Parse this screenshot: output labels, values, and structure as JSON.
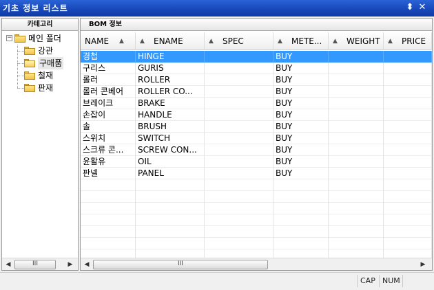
{
  "window": {
    "title": "기초 정보 리스트"
  },
  "title_bar": {
    "menu_glyph": "⬍",
    "close_glyph": "✕"
  },
  "left_panel": {
    "header": "카테고리",
    "tree": {
      "root": {
        "label": "메인 폴더",
        "expander": "−"
      },
      "children": [
        {
          "label": "강관"
        },
        {
          "label": "구매품"
        },
        {
          "label": "철재"
        },
        {
          "label": "판재"
        }
      ]
    },
    "scroll": {
      "left": "◀",
      "right": "▶",
      "thumb": "III"
    }
  },
  "right_panel": {
    "header": "BOM 정보",
    "columns": [
      {
        "label": "NAME"
      },
      {
        "label": "ENAME"
      },
      {
        "label": "SPEC"
      },
      {
        "label": "METE..."
      },
      {
        "label": "WEIGHT"
      },
      {
        "label": "PRICE"
      }
    ],
    "sort_glyph": "▲",
    "rows": [
      {
        "name": "경첩",
        "ename": "HINGE",
        "spec": "",
        "meter": "BUY",
        "weight": "",
        "price": ""
      },
      {
        "name": "구리스",
        "ename": "GURIS",
        "spec": "",
        "meter": "BUY",
        "weight": "",
        "price": ""
      },
      {
        "name": "롤러",
        "ename": "ROLLER",
        "spec": "",
        "meter": "BUY",
        "weight": "",
        "price": ""
      },
      {
        "name": "롤러 콘베어",
        "ename": "ROLLER CO...",
        "spec": "",
        "meter": "BUY",
        "weight": "",
        "price": ""
      },
      {
        "name": "브레이크",
        "ename": "BRAKE",
        "spec": "",
        "meter": "BUY",
        "weight": "",
        "price": ""
      },
      {
        "name": "손잡이",
        "ename": "HANDLE",
        "spec": "",
        "meter": "BUY",
        "weight": "",
        "price": ""
      },
      {
        "name": "솔",
        "ename": "BRUSH",
        "spec": "",
        "meter": "BUY",
        "weight": "",
        "price": ""
      },
      {
        "name": "스위치",
        "ename": "SWITCH",
        "spec": "",
        "meter": "BUY",
        "weight": "",
        "price": ""
      },
      {
        "name": "스크류 콘...",
        "ename": "SCREW CON...",
        "spec": "",
        "meter": "BUY",
        "weight": "",
        "price": ""
      },
      {
        "name": "윤활유",
        "ename": "OIL",
        "spec": "",
        "meter": "BUY",
        "weight": "",
        "price": ""
      },
      {
        "name": "판넬",
        "ename": "PANEL",
        "spec": "",
        "meter": "BUY",
        "weight": "",
        "price": ""
      }
    ],
    "selected_row": 0,
    "scroll": {
      "left": "◀",
      "right": "▶",
      "thumb": "III"
    }
  },
  "status_bar": {
    "cap": "CAP",
    "num": "NUM"
  },
  "colors": {
    "titlebar": "#1747b8",
    "selection": "#3399ff",
    "folder": "#f2c44a"
  }
}
